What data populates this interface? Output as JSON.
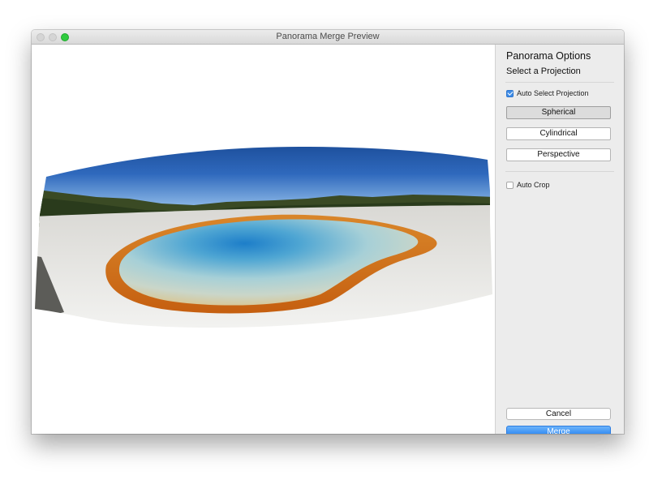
{
  "window": {
    "title": "Panorama Merge Preview"
  },
  "sidebar": {
    "heading": "Panorama Options",
    "subheading": "Select a Projection",
    "auto_select_projection": {
      "label": "Auto Select Projection",
      "checked": true
    },
    "projections": [
      {
        "label": "Spherical",
        "selected": true
      },
      {
        "label": "Cylindrical",
        "selected": false
      },
      {
        "label": "Perspective",
        "selected": false
      }
    ],
    "auto_crop": {
      "label": "Auto Crop",
      "checked": false
    },
    "cancel_label": "Cancel",
    "merge_label": "Merge"
  },
  "colors": {
    "accent": "#1e7ef0",
    "traffic_zoom": "#2fcb3f",
    "sidebar_bg": "#ececec"
  },
  "icons": [
    "checkbox-checked",
    "checkbox-unchecked",
    "window-close",
    "window-minimize",
    "window-zoom"
  ]
}
